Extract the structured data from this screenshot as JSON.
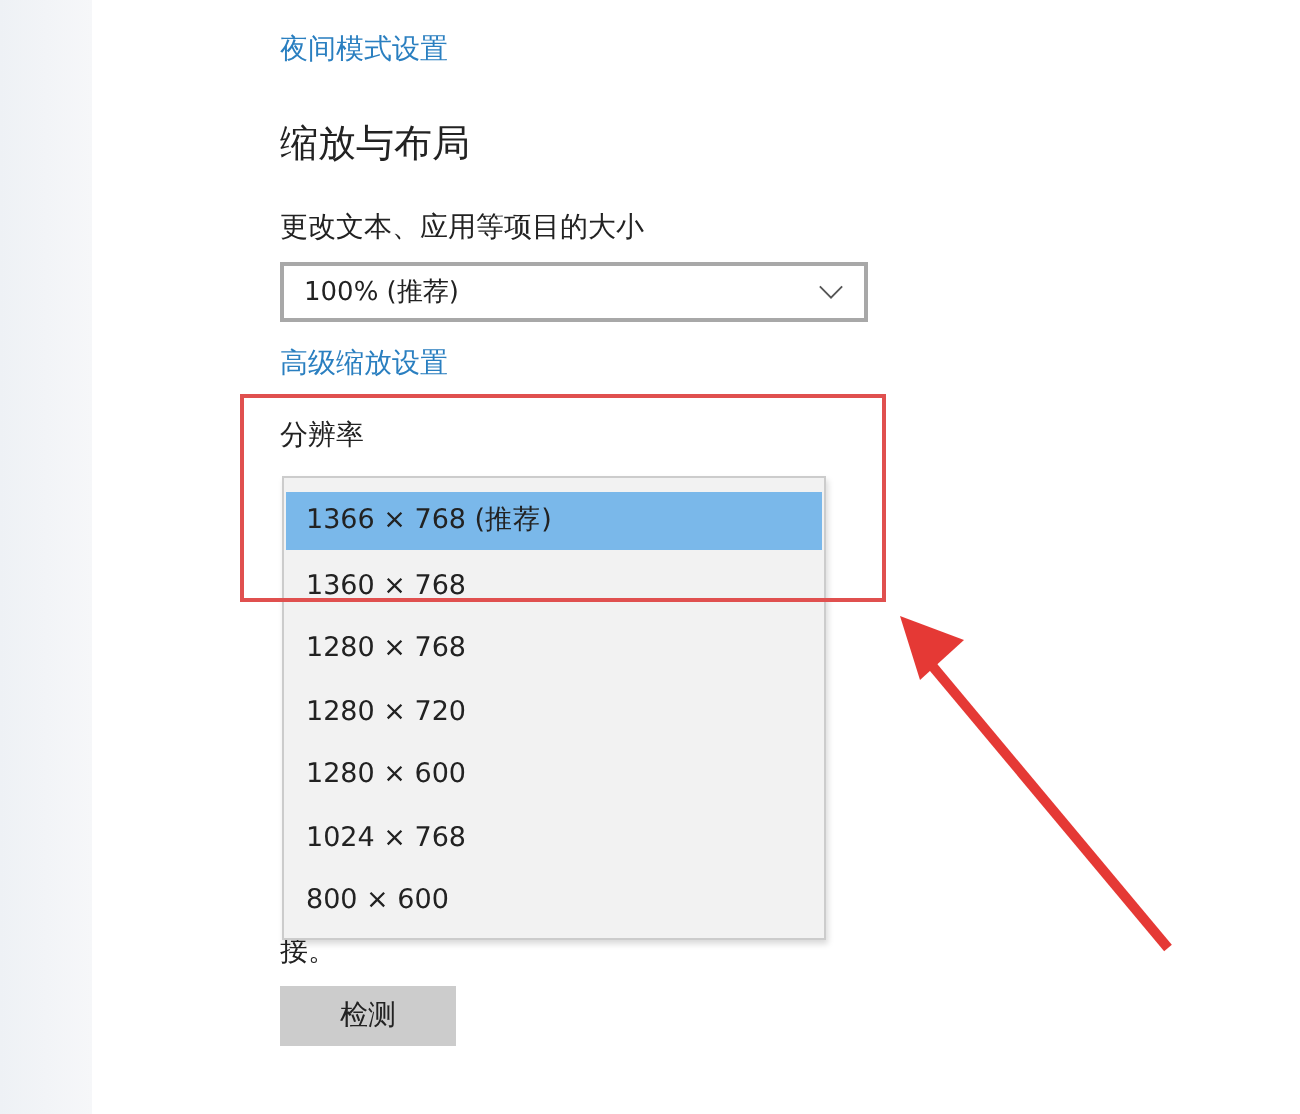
{
  "links": [
    {
      "label": "夜间模式设置"
    }
  ],
  "section": {
    "title": "缩放与布局",
    "scale_label": "更改文本、应用等项目的大小",
    "scale_value": "100% (推荐)",
    "advanced_link": "高级缩放设置",
    "resolution_label": "分辨率"
  },
  "resolution_options": [
    {
      "label": "1366 × 768 (推荐)",
      "selected": true
    },
    {
      "label": "1360 × 768",
      "selected": false
    },
    {
      "label": "1280 × 768",
      "selected": false
    },
    {
      "label": "1280 × 720",
      "selected": false
    },
    {
      "label": "1280 × 600",
      "selected": false
    },
    {
      "label": "1024 × 768",
      "selected": false
    },
    {
      "label": "800 × 600",
      "selected": false
    }
  ],
  "detect": {
    "note_tail": "接。",
    "button": "检测"
  }
}
